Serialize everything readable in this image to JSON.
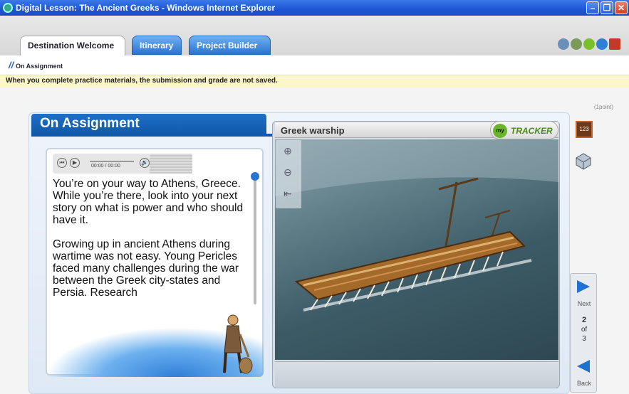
{
  "window": {
    "title": "Digital Lesson: The Ancient Greeks - Windows Internet Explorer"
  },
  "tabs": [
    {
      "label": "Destination Welcome",
      "active": true
    },
    {
      "label": "Itinerary",
      "active": false
    },
    {
      "label": "Project Builder",
      "active": false
    }
  ],
  "breadcrumb": "On Assignment",
  "notice": "When you complete practice materials, the submission and grade are not saved.",
  "points": "(1point)",
  "section": {
    "title": "On Assignment"
  },
  "audio": {
    "time": "00:00 / 00:00"
  },
  "body": {
    "p1": "You’re on your way to Athens, Greece. While you’re there, look into your next story on what is power and who should have it.",
    "p2": "Growing up in ancient  Athens during wartime was not easy. Young Pericles faced many challenges during the war between the Greek city-states and Persia. Research"
  },
  "image": {
    "title": "Greek warship"
  },
  "tracker": {
    "badge": "my",
    "label": "TRACKER"
  },
  "nav": {
    "next": "Next",
    "back": "Back",
    "page_current": "2",
    "page_of": "of",
    "page_total": "3"
  },
  "side_icons": {
    "counter": "123"
  },
  "colors": {
    "accent_blue": "#1d6fc8",
    "notice_bg": "#fbf7c8",
    "tracker_green": "#6bb52a"
  }
}
